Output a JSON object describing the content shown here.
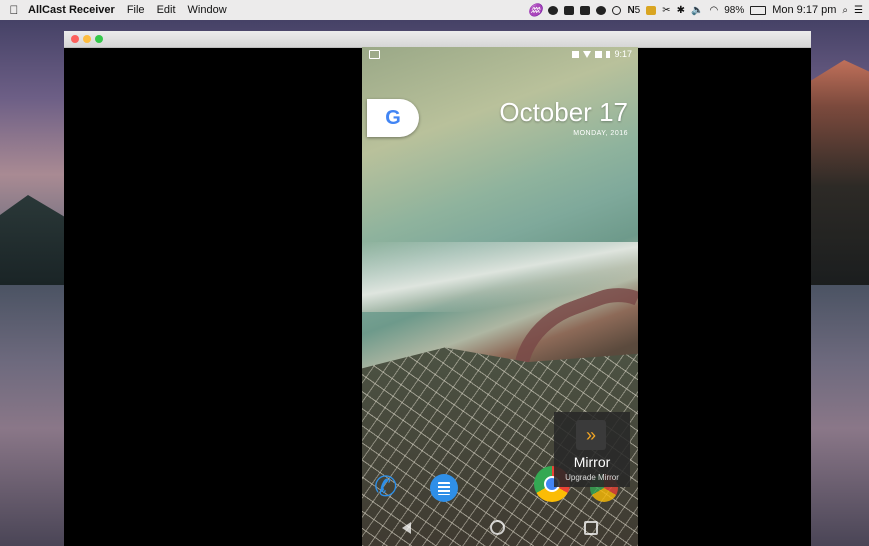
{
  "menubar": {
    "app_name": "AllCast Receiver",
    "menus": [
      "File",
      "Edit",
      "Window"
    ],
    "status": {
      "status_number": "5",
      "battery_percent": "98%",
      "clock": "Mon 9:17 pm"
    }
  },
  "phone": {
    "status_time": "9:17",
    "date": "October 17",
    "weekday": "MONDAY, 2016",
    "google_logo": "G",
    "mirror_popup": {
      "label": "Mirror",
      "sub_label": "Upgrade Mirror"
    }
  }
}
